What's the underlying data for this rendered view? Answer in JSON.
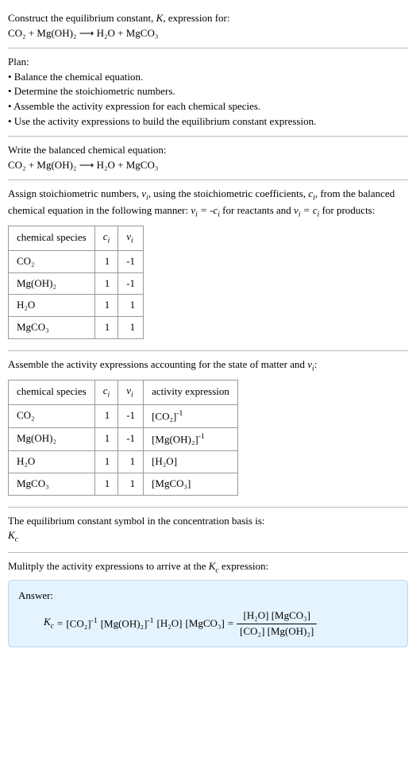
{
  "intro": {
    "line1_a": "Construct the equilibrium constant, ",
    "line1_b": ", expression for:",
    "eqn": "CO₂ + Mg(OH)₂ ⟶ H₂O + MgCO₃"
  },
  "plan": {
    "heading": "Plan:",
    "b1": "• Balance the chemical equation.",
    "b2": "• Determine the stoichiometric numbers.",
    "b3": "• Assemble the activity expression for each chemical species.",
    "b4": "• Use the activity expressions to build the equilibrium constant expression."
  },
  "balanced": {
    "heading": "Write the balanced chemical equation:",
    "eqn": "CO₂ + Mg(OH)₂ ⟶ H₂O + MgCO₃"
  },
  "stoich_text": {
    "a": "Assign stoichiometric numbers, ",
    "b": ", using the stoichiometric coefficients, ",
    "c": ", from the balanced chemical equation in the following manner: ",
    "d": " for reactants and ",
    "e": " for products:"
  },
  "table1": {
    "h1": "chemical species",
    "rows": [
      {
        "sp": "CO₂",
        "ci": "1",
        "vi": "-1"
      },
      {
        "sp": "Mg(OH)₂",
        "ci": "1",
        "vi": "-1"
      },
      {
        "sp": "H₂O",
        "ci": "1",
        "vi": "1"
      },
      {
        "sp": "MgCO₃",
        "ci": "1",
        "vi": "1"
      }
    ]
  },
  "activity_text": {
    "a": "Assemble the activity expressions accounting for the state of matter and ",
    "b": ":"
  },
  "table2": {
    "h1": "chemical species",
    "h4": "activity expression",
    "rows": [
      {
        "sp": "CO₂",
        "ci": "1",
        "vi": "-1"
      },
      {
        "sp": "Mg(OH)₂",
        "ci": "1",
        "vi": "-1"
      },
      {
        "sp": "H₂O",
        "ci": "1",
        "vi": "1",
        "act": "[H₂O]"
      },
      {
        "sp": "MgCO₃",
        "ci": "1",
        "vi": "1",
        "act": "[MgCO₃]"
      }
    ]
  },
  "kc_symbol_text": "The equilibrium constant symbol in the concentration basis is:",
  "multiply_text": {
    "a": "Mulitply the activity expressions to arrive at the ",
    "b": " expression:"
  },
  "answer": {
    "label": "Answer:",
    "frac_num": "[H₂O] [MgCO₃]",
    "frac_den": "[CO₂] [Mg(OH)₂]"
  },
  "chart_data": {
    "type": "table",
    "tables": [
      {
        "headers": [
          "chemical species",
          "c_i",
          "ν_i"
        ],
        "rows": [
          [
            "CO₂",
            1,
            -1
          ],
          [
            "Mg(OH)₂",
            1,
            -1
          ],
          [
            "H₂O",
            1,
            1
          ],
          [
            "MgCO₃",
            1,
            1
          ]
        ]
      },
      {
        "headers": [
          "chemical species",
          "c_i",
          "ν_i",
          "activity expression"
        ],
        "rows": [
          [
            "CO₂",
            1,
            -1,
            "[CO₂]^-1"
          ],
          [
            "Mg(OH)₂",
            1,
            -1,
            "[Mg(OH)₂]^-1"
          ],
          [
            "H₂O",
            1,
            1,
            "[H₂O]"
          ],
          [
            "MgCO₃",
            1,
            1,
            "[MgCO₃]"
          ]
        ]
      }
    ]
  }
}
